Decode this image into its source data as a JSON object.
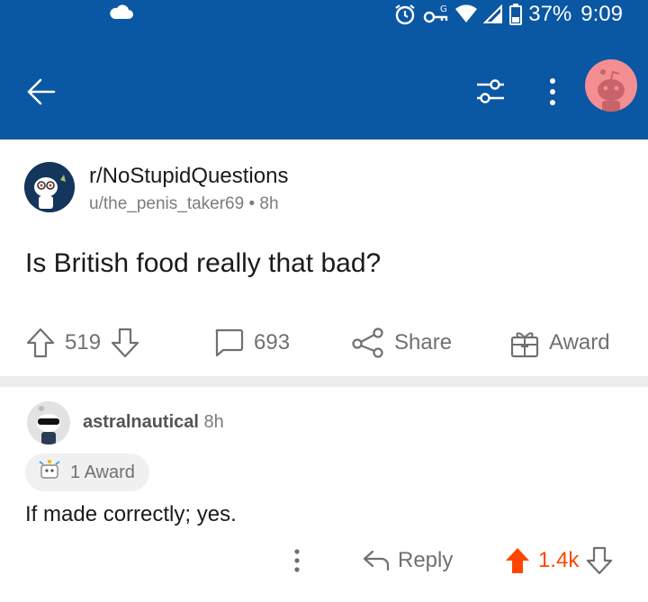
{
  "status_bar": {
    "battery": "37%",
    "time": "9:09",
    "icons": [
      "cloud-icon",
      "alarm-icon",
      "vpn-key-icon",
      "wifi-icon",
      "signal-icon",
      "battery-icon"
    ]
  },
  "nav": {
    "icons": [
      "back-arrow-icon",
      "filter-icon",
      "more-vertical-icon",
      "avatar"
    ]
  },
  "post": {
    "subreddit": "r/NoStupidQuestions",
    "author": "u/the_penis_taker69",
    "separator": "•",
    "age": "8h",
    "title": "Is British food really that bad?",
    "upvotes": "519",
    "comments": "693",
    "share_label": "Share",
    "award_label": "Award"
  },
  "comment": {
    "author": "astralnautical",
    "age": "8h",
    "awards": "1 Award",
    "text": "If made correctly; yes.",
    "reply_label": "Reply",
    "score": "1.4k"
  },
  "colors": {
    "header_bg": "#0a57a3",
    "upvote_active": "#ff4500",
    "divider": "#ececec",
    "muted_text": "#707070"
  }
}
